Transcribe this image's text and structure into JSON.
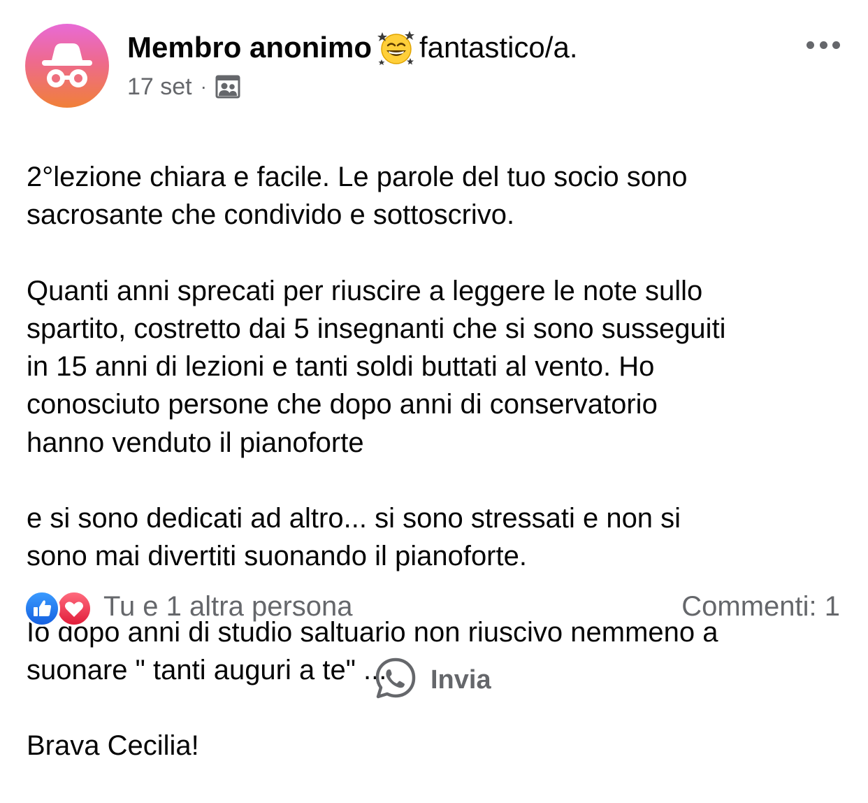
{
  "post": {
    "author": "Membro anonimo",
    "feeling_text": "fantastico/a.",
    "feeling_icon": "star-struck-laughing-emoji",
    "date": "17 set",
    "separator": "·",
    "audience_icon": "group-members-icon",
    "more_icon": "more-options-icon",
    "body": {
      "paragraphs": [
        "2°lezione chiara e facile. Le parole del tuo socio sono\nsacrosante che condivido e sottoscrivo.",
        "Quanti anni sprecati per riuscire a leggere le note sullo\nspartito, costretto dai 5 insegnanti che si sono susseguiti\nin 15 anni di lezioni e tanti soldi  buttati al vento. Ho\nconosciuto persone che dopo anni di conservatorio\nhanno venduto il pianoforte",
        "e si sono dedicati ad altro... si sono stressati e non si\nsono mai divertiti suonando il pianoforte.",
        "Io dopo anni di studio saltuario non riuscivo nemmeno a\nsuonare \" tanti auguri a te\" ...",
        "Brava Cecilia!"
      ]
    }
  },
  "reactions": {
    "icons": [
      "like-icon",
      "love-icon"
    ],
    "text": "Tu e 1 altra persona"
  },
  "comments": {
    "text": "Commenti: 1"
  },
  "share": {
    "icon": "whatsapp-icon",
    "label": "Invia"
  },
  "colors": {
    "secondary_text": "#65676b",
    "primary_text": "#050505",
    "like_blue": "#1877f2",
    "love_red": "#f33e58"
  }
}
